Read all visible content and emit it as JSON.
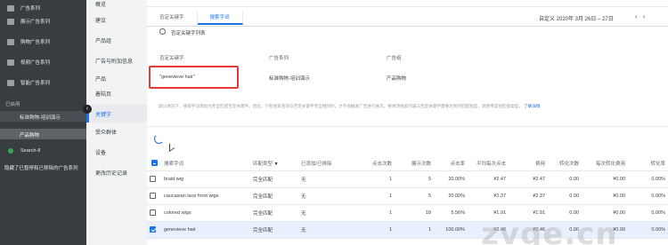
{
  "sidebar": {
    "campaigns": [
      {
        "label": "广告系列"
      },
      {
        "label": "展示广告系列"
      },
      {
        "label": "购物广告系列"
      },
      {
        "label": "视频广告系列"
      },
      {
        "label": "智能广告系列"
      }
    ],
    "section_label": "已启用",
    "active_campaign": "标准购物-培训演示",
    "active_adgroup": "产品购物",
    "search_campaign": "Search-8",
    "bottom_text": "隐藏了已暂停和已移除的广告系列"
  },
  "nav": {
    "items": [
      "概览",
      "建议",
      "产品组",
      "广告与附加信息",
      "产品",
      "着陆页",
      "关键字",
      "受众群体",
      "设备",
      "更改历史记录"
    ],
    "active": "关键字"
  },
  "tabs": [
    {
      "label": "否定关键字",
      "active": false
    },
    {
      "label": "搜索字词",
      "active": true
    }
  ],
  "date_range": "自定义  2020年 3月 26日 – 27日",
  "negative_keyword_list": "否定关键字列表",
  "form": {
    "headers": {
      "negative_keyword": "否定关键字",
      "campaign": "广告系列",
      "ad_group": "广告组"
    },
    "keyword_value": "\"genevieve hair\"",
    "campaign_value": "标准购物-培训演示",
    "adgroup_value": "产品购物"
  },
  "info": {
    "text": "默认情况下，搜索字词添加为完全匹配否定关键字。因此，只有搜索查询与否定关键字完全相同时，才不会触发广告进行展示。要更改搜索内容与否定关键字需要达到的匹配程度，请使用其他匹配类型。",
    "more_link": "了解详情"
  },
  "table": {
    "columns": [
      "搜索字词",
      "匹配类型",
      "已添加/已排除",
      "点击次数",
      "展示次数",
      "点击率",
      "平均每次点击",
      "费用",
      "转化次数",
      "每次转化费用",
      "转化率"
    ],
    "rows": [
      {
        "term": "braid wig",
        "match": "完全匹配",
        "added": "无",
        "clicks": "1",
        "impr": "5",
        "ctr": "20.00%",
        "cpc": "¥2.47",
        "cost": "¥2.47",
        "conv": "0.00",
        "cpa": "¥0.00",
        "convrate": "0.00%",
        "selected": false
      },
      {
        "term": "caucasian lace front wigs",
        "match": "完全匹配",
        "added": "无",
        "clicks": "1",
        "impr": "5",
        "ctr": "20.00%",
        "cpc": "¥2.37",
        "cost": "¥2.37",
        "conv": "0.00",
        "cpa": "¥0.00",
        "convrate": "0.00%",
        "selected": false
      },
      {
        "term": "colored wigs",
        "match": "完全匹配",
        "added": "无",
        "clicks": "1",
        "impr": "18",
        "ctr": "5.56%",
        "cpc": "¥1.91",
        "cost": "¥1.91",
        "conv": "0.00",
        "cpa": "¥0.00",
        "convrate": "0.00%",
        "selected": false
      },
      {
        "term": "genevieve hair",
        "match": "完全匹配",
        "added": "无",
        "clicks": "1",
        "impr": "1",
        "ctr": "100.00%",
        "cpc": "¥2.46",
        "cost": "¥2.46",
        "conv": "0.00",
        "cpa": "¥0.00",
        "convrate": "0.00%",
        "selected": true
      }
    ]
  },
  "watermark": "zvge.cn",
  "colors": {
    "accent": "#1a73e8",
    "highlight": "#e53935",
    "sidebar": "#3a3d40"
  }
}
